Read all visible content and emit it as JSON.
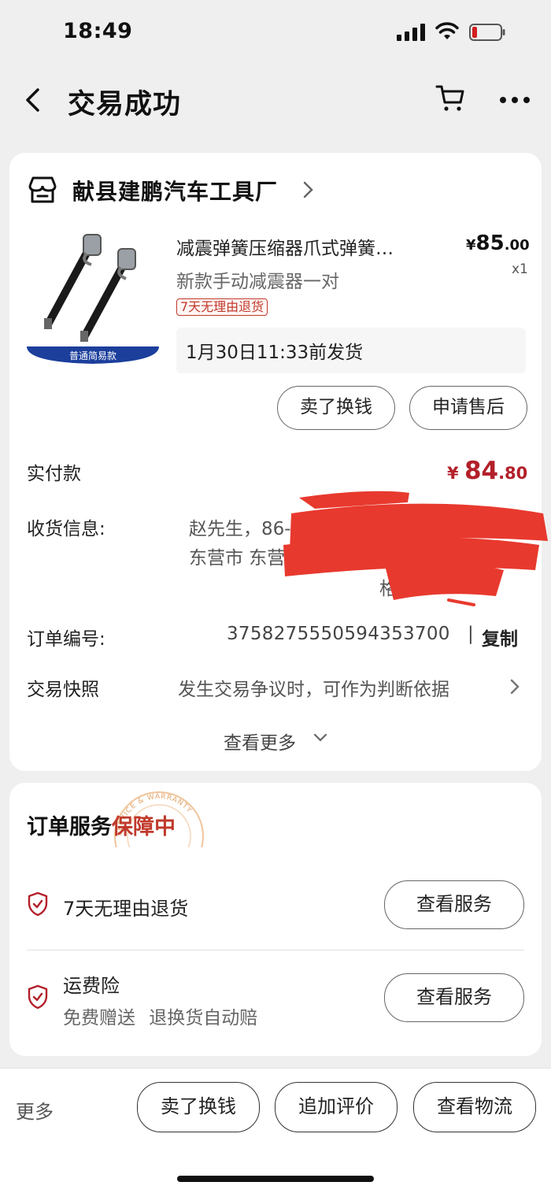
{
  "status_bar": {
    "time": "18:49"
  },
  "nav": {
    "title": "交易成功"
  },
  "shop": {
    "name": "献县建鹏汽车工具厂"
  },
  "product": {
    "image_caption": "普通简易款",
    "title": "减震弹簧压缩器爪式弹簧…",
    "spec": "新款手动减震器一对",
    "price_symbol": "¥",
    "price_int": "85",
    "price_dec": ".00",
    "qty": "x1",
    "return_tag": "7天无理由退货",
    "ship_note": "1月30日11:33前发货",
    "btn_sell": "卖了换钱",
    "btn_after_sale": "申请售后"
  },
  "details": {
    "paid_label": "实付款",
    "paid_symbol": "¥ ",
    "paid_int": "84",
    "paid_dec": ".80",
    "address_label": "收货信息:",
    "address_line1": "赵先生，86-15",
    "address_line2": "东营市 东营",
    "address_line3": "格",
    "order_label": "订单编号:",
    "order_no": "3758275550594353700",
    "order_sep": "|",
    "copy": "复制",
    "snapshot_label": "交易快照",
    "snapshot_value": "发生交易争议时，可作为判断依据",
    "see_more": "查看更多"
  },
  "service": {
    "title_main": "订单服务",
    "title_highlight": "保障中",
    "seal_text": "SERVICE & WARRANTY",
    "items": [
      {
        "label": "7天无理由退货",
        "button": "查看服务"
      },
      {
        "label": "运费险",
        "sub": "免费赠送  退换货自动赔",
        "button": "查看服务"
      }
    ]
  },
  "bottom_bar": {
    "more": "更多",
    "buttons": [
      "卖了换钱",
      "追加评价",
      "查看物流"
    ]
  },
  "colors": {
    "accent_red": "#b3202a",
    "tag_red": "#c0392b",
    "redaction": "#e8392e"
  }
}
